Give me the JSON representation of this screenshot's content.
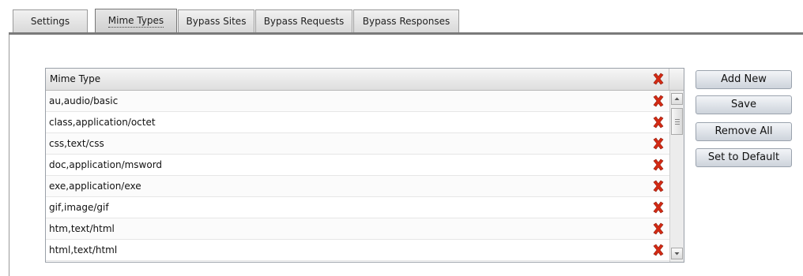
{
  "tabs": [
    {
      "label": "Settings",
      "active": false
    },
    {
      "label": "Mime Types",
      "active": true
    },
    {
      "label": "Bypass Sites",
      "active": false
    },
    {
      "label": "Bypass Requests",
      "active": false
    },
    {
      "label": "Bypass Responses",
      "active": false
    }
  ],
  "grid": {
    "header": "Mime Type",
    "delete_icon": "delete-x-icon",
    "delete_color": "#d42a14",
    "rows": [
      "au,audio/basic",
      "class,application/octet",
      "css,text/css",
      "doc,application/msword",
      "exe,application/exe",
      "gif,image/gif",
      "htm,text/html",
      "html,text/html"
    ]
  },
  "buttons": {
    "add_new": "Add New",
    "save": "Save",
    "remove_all": "Remove All",
    "set_default": "Set to Default"
  }
}
